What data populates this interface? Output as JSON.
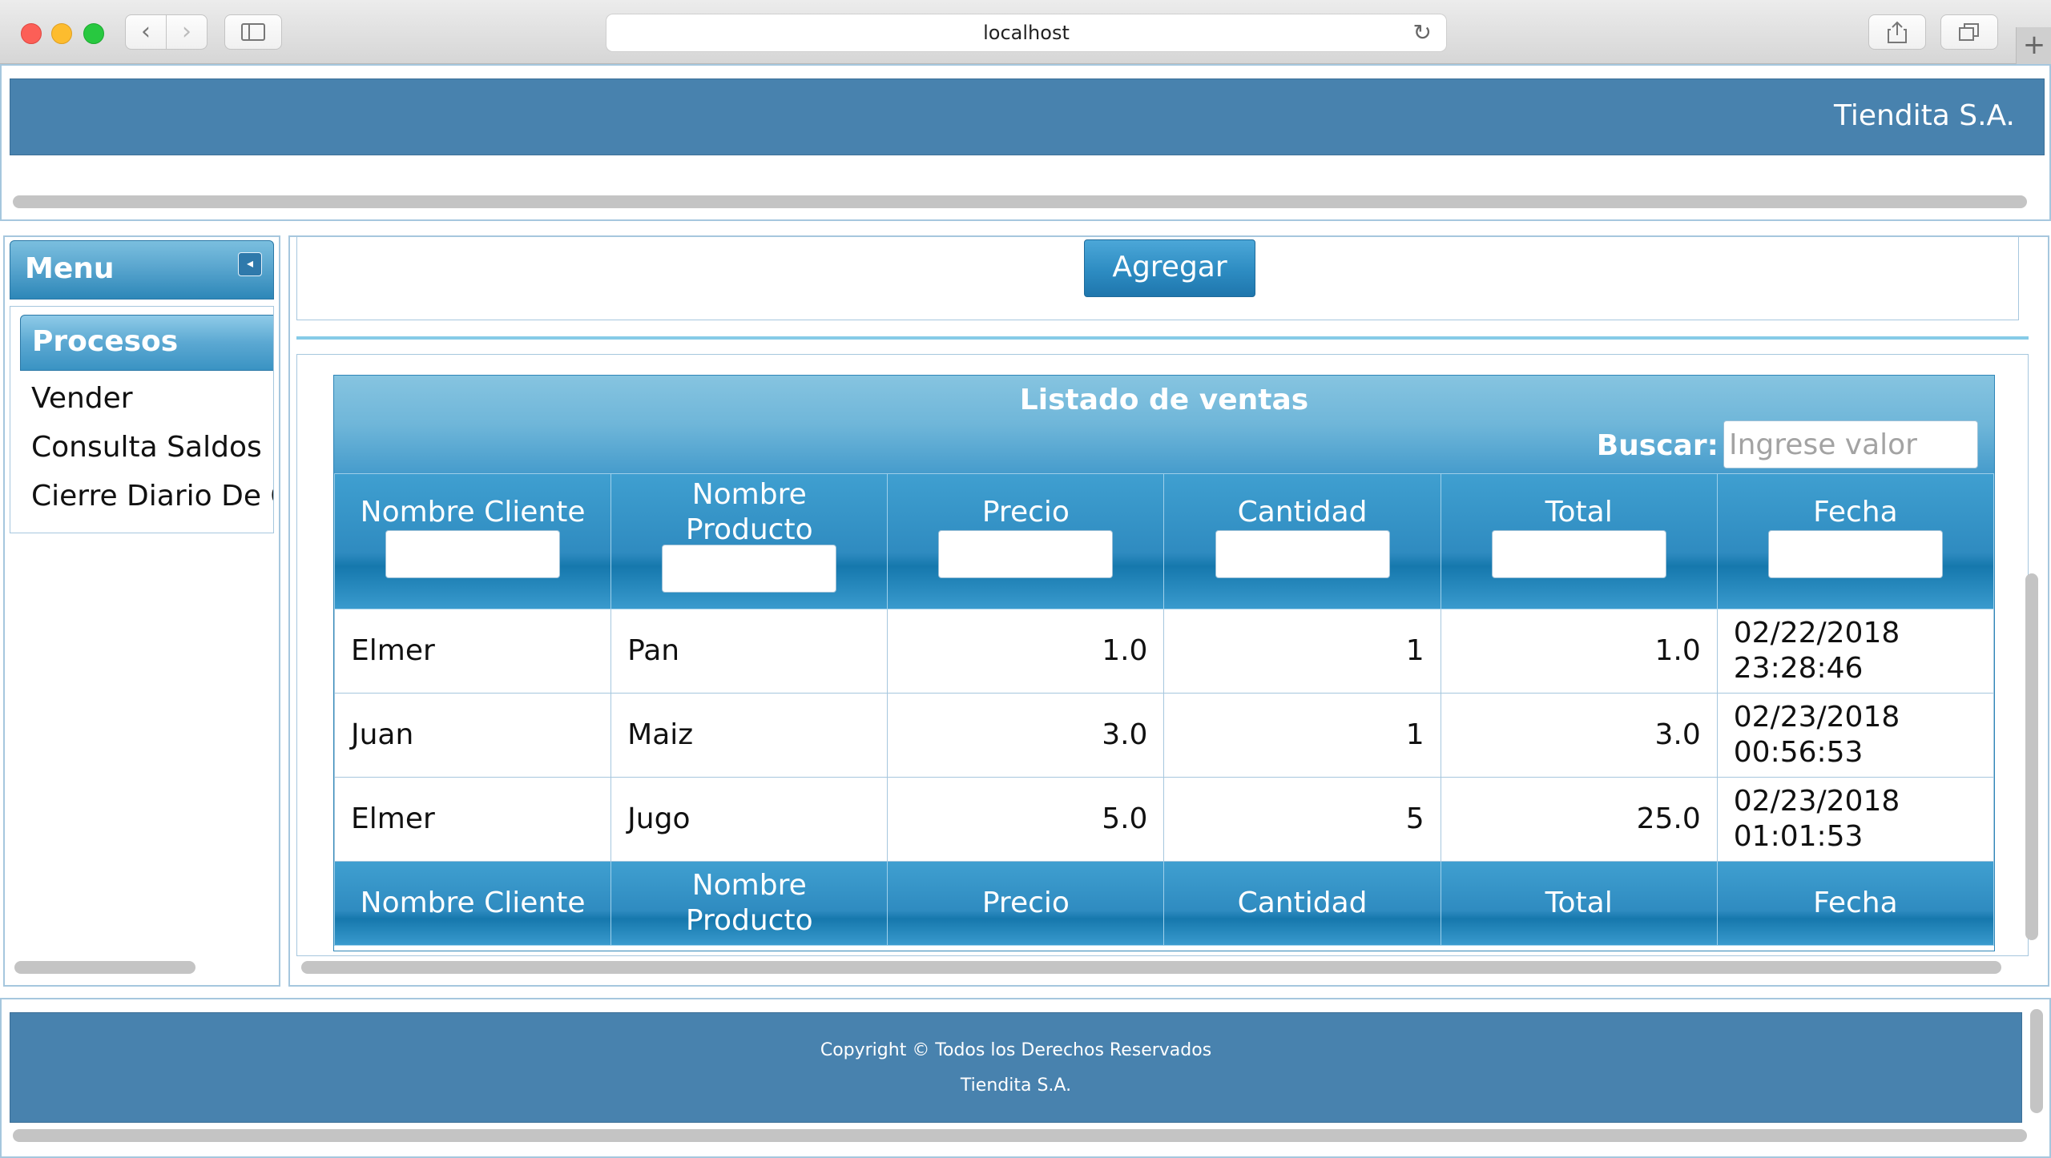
{
  "browser": {
    "url": "localhost",
    "reload_icon": "↻",
    "back_icon": "‹",
    "forward_icon": "›",
    "new_tab_icon": "+"
  },
  "header": {
    "company": "Tiendita S.A."
  },
  "menu": {
    "title": "Menu",
    "collapse_icon": "◂",
    "group": "Procesos",
    "items": [
      "Vender",
      "Consulta Saldos",
      "Cierre Diario De Caja"
    ]
  },
  "toolbar": {
    "add_label": "Agregar"
  },
  "sales_table": {
    "caption": "Listado de ventas",
    "search_label": "Buscar:",
    "search_placeholder": "Ingrese valor",
    "columns": [
      "Nombre Cliente",
      "Nombre Producto",
      "Precio",
      "Cantidad",
      "Total",
      "Fecha"
    ],
    "rows": [
      [
        "Elmer",
        "Pan",
        "1.0",
        "1",
        "1.0",
        "02/22/2018 23:28:46"
      ],
      [
        "Juan",
        "Maiz",
        "3.0",
        "1",
        "3.0",
        "02/23/2018 00:56:53"
      ],
      [
        "Elmer",
        "Jugo",
        "5.0",
        "5",
        "25.0",
        "02/23/2018 01:01:53"
      ]
    ]
  },
  "footer": {
    "copyright": "Copyright © Todos los Derechos Reservados",
    "company": "Tiendita S.A."
  },
  "colors": {
    "header_blue": "#4882ae",
    "accent_blue": "#2d8cc2",
    "border": "#a6c7de"
  }
}
